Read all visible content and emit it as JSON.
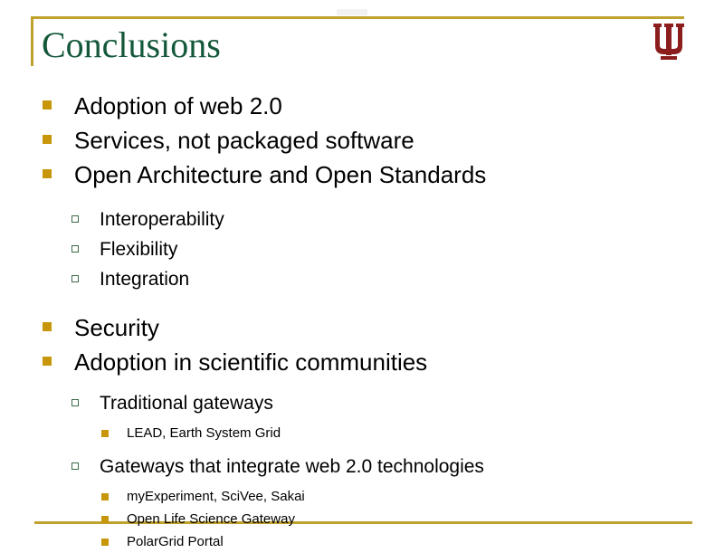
{
  "slide": {
    "title": "Conclusions",
    "logo_name": "indiana-university-trident-logo",
    "colors": {
      "title_green": "#14583a",
      "rule_gold": "#bfa22e",
      "bullet_gold": "#c8960a",
      "bullet_green_outline": "#3c6b47",
      "logo_crimson": "#8c1d1d",
      "background": "#ffffff",
      "text_black": "#000000"
    },
    "bullets": [
      {
        "level": 1,
        "text": "Adoption of web 2.0"
      },
      {
        "level": 1,
        "text": "Services, not packaged software"
      },
      {
        "level": 1,
        "text": "Open Architecture and Open Standards"
      },
      {
        "level": 2,
        "text": "Interoperability"
      },
      {
        "level": 2,
        "text": "Flexibility"
      },
      {
        "level": 2,
        "text": "Integration"
      },
      {
        "level": 1,
        "text": "Security"
      },
      {
        "level": 1,
        "text": "Adoption in scientific communities"
      },
      {
        "level": 2,
        "text": "Traditional gateways"
      },
      {
        "level": 3,
        "text": "LEAD, Earth System Grid"
      },
      {
        "level": 2,
        "text": "Gateways that integrate web 2.0 technologies"
      },
      {
        "level": 3,
        "text": "myExperiment, SciVee, Sakai"
      },
      {
        "level": 3,
        "text": "Open Life Science Gateway"
      },
      {
        "level": 3,
        "text": "PolarGrid Portal"
      }
    ]
  }
}
